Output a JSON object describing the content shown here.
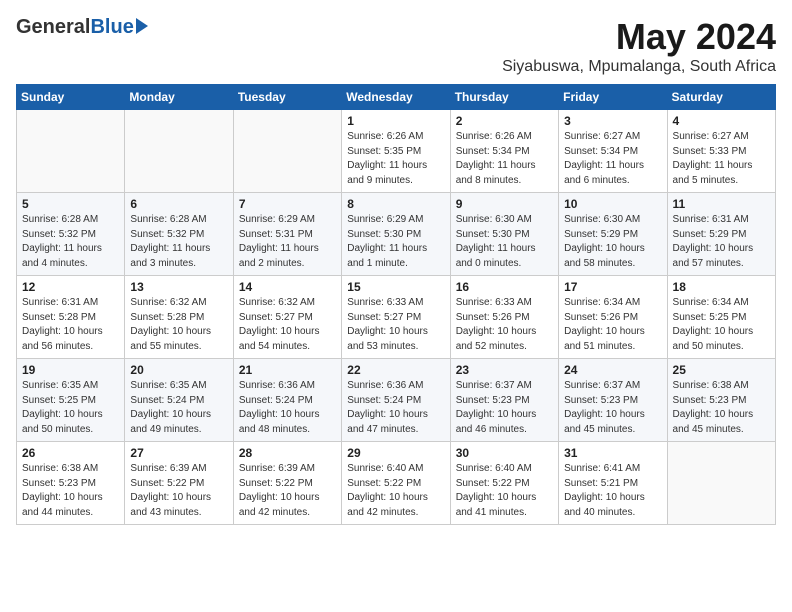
{
  "header": {
    "logo_general": "General",
    "logo_blue": "Blue",
    "title": "May 2024",
    "location": "Siyabuswa, Mpumalanga, South Africa"
  },
  "days_of_week": [
    "Sunday",
    "Monday",
    "Tuesday",
    "Wednesday",
    "Thursday",
    "Friday",
    "Saturday"
  ],
  "weeks": [
    [
      {
        "day": "",
        "info": ""
      },
      {
        "day": "",
        "info": ""
      },
      {
        "day": "",
        "info": ""
      },
      {
        "day": "1",
        "info": "Sunrise: 6:26 AM\nSunset: 5:35 PM\nDaylight: 11 hours\nand 9 minutes."
      },
      {
        "day": "2",
        "info": "Sunrise: 6:26 AM\nSunset: 5:34 PM\nDaylight: 11 hours\nand 8 minutes."
      },
      {
        "day": "3",
        "info": "Sunrise: 6:27 AM\nSunset: 5:34 PM\nDaylight: 11 hours\nand 6 minutes."
      },
      {
        "day": "4",
        "info": "Sunrise: 6:27 AM\nSunset: 5:33 PM\nDaylight: 11 hours\nand 5 minutes."
      }
    ],
    [
      {
        "day": "5",
        "info": "Sunrise: 6:28 AM\nSunset: 5:32 PM\nDaylight: 11 hours\nand 4 minutes."
      },
      {
        "day": "6",
        "info": "Sunrise: 6:28 AM\nSunset: 5:32 PM\nDaylight: 11 hours\nand 3 minutes."
      },
      {
        "day": "7",
        "info": "Sunrise: 6:29 AM\nSunset: 5:31 PM\nDaylight: 11 hours\nand 2 minutes."
      },
      {
        "day": "8",
        "info": "Sunrise: 6:29 AM\nSunset: 5:30 PM\nDaylight: 11 hours\nand 1 minute."
      },
      {
        "day": "9",
        "info": "Sunrise: 6:30 AM\nSunset: 5:30 PM\nDaylight: 11 hours\nand 0 minutes."
      },
      {
        "day": "10",
        "info": "Sunrise: 6:30 AM\nSunset: 5:29 PM\nDaylight: 10 hours\nand 58 minutes."
      },
      {
        "day": "11",
        "info": "Sunrise: 6:31 AM\nSunset: 5:29 PM\nDaylight: 10 hours\nand 57 minutes."
      }
    ],
    [
      {
        "day": "12",
        "info": "Sunrise: 6:31 AM\nSunset: 5:28 PM\nDaylight: 10 hours\nand 56 minutes."
      },
      {
        "day": "13",
        "info": "Sunrise: 6:32 AM\nSunset: 5:28 PM\nDaylight: 10 hours\nand 55 minutes."
      },
      {
        "day": "14",
        "info": "Sunrise: 6:32 AM\nSunset: 5:27 PM\nDaylight: 10 hours\nand 54 minutes."
      },
      {
        "day": "15",
        "info": "Sunrise: 6:33 AM\nSunset: 5:27 PM\nDaylight: 10 hours\nand 53 minutes."
      },
      {
        "day": "16",
        "info": "Sunrise: 6:33 AM\nSunset: 5:26 PM\nDaylight: 10 hours\nand 52 minutes."
      },
      {
        "day": "17",
        "info": "Sunrise: 6:34 AM\nSunset: 5:26 PM\nDaylight: 10 hours\nand 51 minutes."
      },
      {
        "day": "18",
        "info": "Sunrise: 6:34 AM\nSunset: 5:25 PM\nDaylight: 10 hours\nand 50 minutes."
      }
    ],
    [
      {
        "day": "19",
        "info": "Sunrise: 6:35 AM\nSunset: 5:25 PM\nDaylight: 10 hours\nand 50 minutes."
      },
      {
        "day": "20",
        "info": "Sunrise: 6:35 AM\nSunset: 5:24 PM\nDaylight: 10 hours\nand 49 minutes."
      },
      {
        "day": "21",
        "info": "Sunrise: 6:36 AM\nSunset: 5:24 PM\nDaylight: 10 hours\nand 48 minutes."
      },
      {
        "day": "22",
        "info": "Sunrise: 6:36 AM\nSunset: 5:24 PM\nDaylight: 10 hours\nand 47 minutes."
      },
      {
        "day": "23",
        "info": "Sunrise: 6:37 AM\nSunset: 5:23 PM\nDaylight: 10 hours\nand 46 minutes."
      },
      {
        "day": "24",
        "info": "Sunrise: 6:37 AM\nSunset: 5:23 PM\nDaylight: 10 hours\nand 45 minutes."
      },
      {
        "day": "25",
        "info": "Sunrise: 6:38 AM\nSunset: 5:23 PM\nDaylight: 10 hours\nand 45 minutes."
      }
    ],
    [
      {
        "day": "26",
        "info": "Sunrise: 6:38 AM\nSunset: 5:23 PM\nDaylight: 10 hours\nand 44 minutes."
      },
      {
        "day": "27",
        "info": "Sunrise: 6:39 AM\nSunset: 5:22 PM\nDaylight: 10 hours\nand 43 minutes."
      },
      {
        "day": "28",
        "info": "Sunrise: 6:39 AM\nSunset: 5:22 PM\nDaylight: 10 hours\nand 42 minutes."
      },
      {
        "day": "29",
        "info": "Sunrise: 6:40 AM\nSunset: 5:22 PM\nDaylight: 10 hours\nand 42 minutes."
      },
      {
        "day": "30",
        "info": "Sunrise: 6:40 AM\nSunset: 5:22 PM\nDaylight: 10 hours\nand 41 minutes."
      },
      {
        "day": "31",
        "info": "Sunrise: 6:41 AM\nSunset: 5:21 PM\nDaylight: 10 hours\nand 40 minutes."
      },
      {
        "day": "",
        "info": ""
      }
    ]
  ]
}
